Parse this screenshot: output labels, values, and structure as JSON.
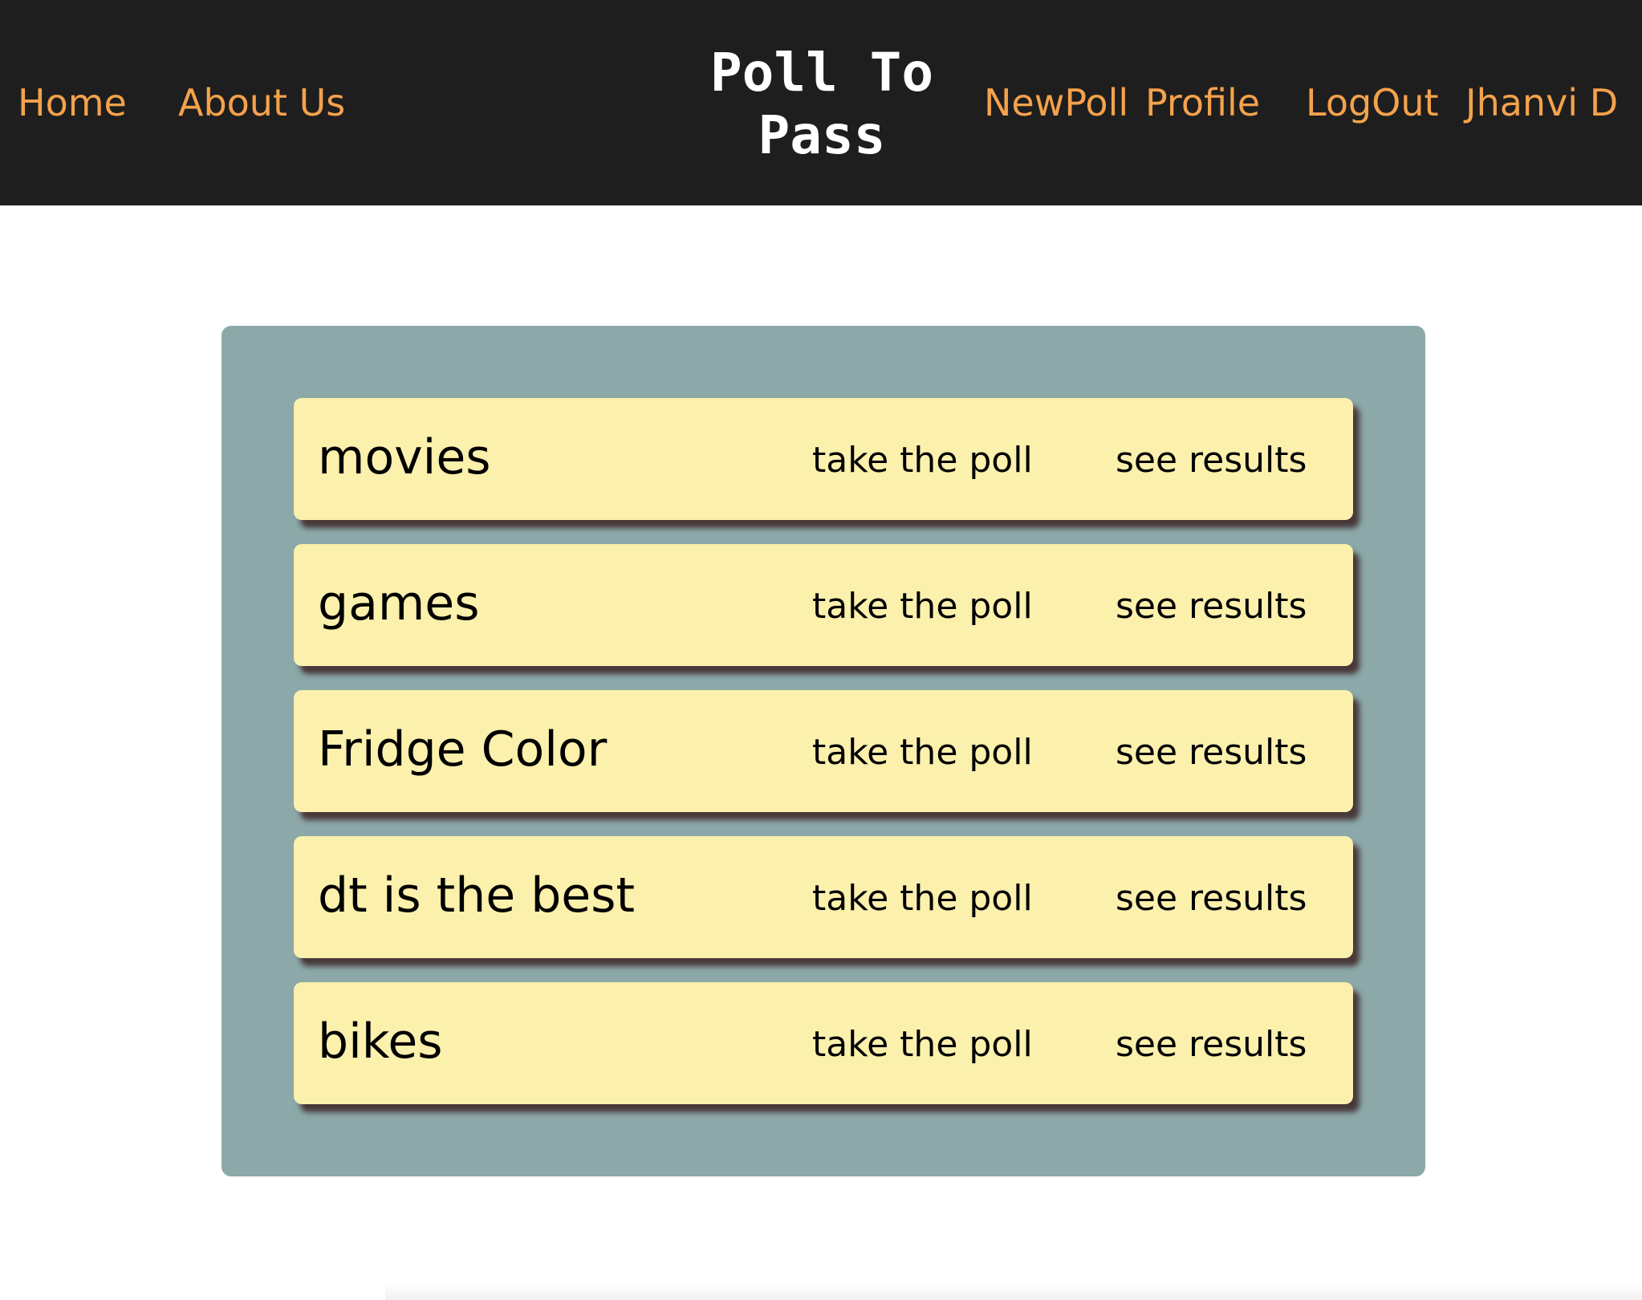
{
  "header": {
    "title": "Poll To Pass",
    "nav_left": {
      "home": "Home",
      "about": "About Us"
    },
    "nav_right": {
      "new_poll": "NewPoll",
      "profile": "Profile",
      "logout": "LogOut",
      "user": "Jhanvi D"
    }
  },
  "polls": [
    {
      "name": "movies",
      "take_label": "take the poll",
      "results_label": "see results"
    },
    {
      "name": "games",
      "take_label": "take the poll",
      "results_label": "see results"
    },
    {
      "name": "Fridge Color",
      "take_label": "take the poll",
      "results_label": "see results"
    },
    {
      "name": "dt is the best",
      "take_label": "take the poll",
      "results_label": "see results"
    },
    {
      "name": "bikes",
      "take_label": "take the poll",
      "results_label": "see results"
    }
  ],
  "colors": {
    "header_bg": "#1e1e1e",
    "nav_link": "#f4a24c",
    "title": "#ffffff",
    "panel_bg": "#8ca8a9",
    "card_bg": "#fbf0ac",
    "card_shadow": "#3c2426"
  }
}
